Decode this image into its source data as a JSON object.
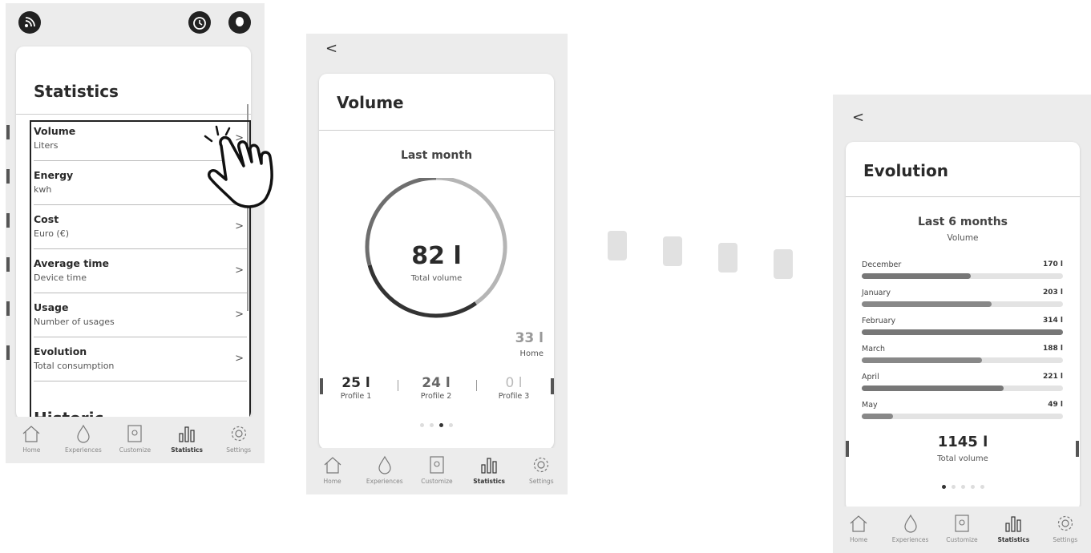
{
  "screen1": {
    "title": "Statistics",
    "items": [
      {
        "title": "Volume",
        "subtitle": "Liters",
        "chevron": ">"
      },
      {
        "title": "Energy",
        "subtitle": "kwh",
        "chevron": ">"
      },
      {
        "title": "Cost",
        "subtitle": "Euro (€)",
        "chevron": ">"
      },
      {
        "title": "Average time",
        "subtitle": "Device time",
        "chevron": ">"
      },
      {
        "title": "Usage",
        "subtitle": "Number of usages",
        "chevron": ">"
      },
      {
        "title": "Evolution",
        "subtitle": "Total consumption",
        "chevron": ">"
      }
    ],
    "next_section": "Historic"
  },
  "nav": {
    "items": [
      {
        "label": "Home",
        "icon": "home-icon"
      },
      {
        "label": "Experiences",
        "icon": "drop-icon"
      },
      {
        "label": "Customize",
        "icon": "device-icon"
      },
      {
        "label": "Statistics",
        "icon": "bar-chart-icon"
      },
      {
        "label": "Settings",
        "icon": "gear-icon"
      }
    ],
    "active": "Statistics"
  },
  "screen2": {
    "back": "<",
    "title": "Volume",
    "period": "Last month",
    "total_value": "82 l",
    "total_label": "Total volume",
    "home_value": "33 l",
    "home_label": "Home",
    "profiles": [
      {
        "value": "25 l",
        "name": "Profile 1"
      },
      {
        "value": "24 l",
        "name": "Profile 2"
      },
      {
        "value": "0 l",
        "name": "Profile 3"
      }
    ],
    "page_count": 4,
    "active_page": 3
  },
  "screen3": {
    "back": "<",
    "title": "Evolution",
    "period": "Last 6 months",
    "metric": "Volume",
    "total_value": "1145 l",
    "total_label": "Total volume",
    "page_count": 5,
    "active_page": 1
  },
  "chart_data": [
    {
      "type": "pie",
      "categories": [
        "Home",
        "Profile 1",
        "Profile 2",
        "Profile 3"
      ],
      "values": [
        33,
        25,
        24,
        0
      ],
      "units": "l",
      "title": "Last month"
    },
    {
      "type": "bar",
      "orientation": "horizontal",
      "title": "Last 6 months",
      "categories": [
        "December",
        "January",
        "February",
        "March",
        "April",
        "May"
      ],
      "values": [
        170,
        203,
        314,
        188,
        221,
        49
      ],
      "labels": [
        "170 l",
        "203 l",
        "314 l",
        "188 l",
        "221 l",
        "49 l"
      ],
      "xlim": [
        0,
        314
      ]
    }
  ],
  "colors": {
    "background": "#ececec",
    "card": "#ffffff",
    "bar_fill": "#888888",
    "bar_track": "#e3e3e3"
  }
}
